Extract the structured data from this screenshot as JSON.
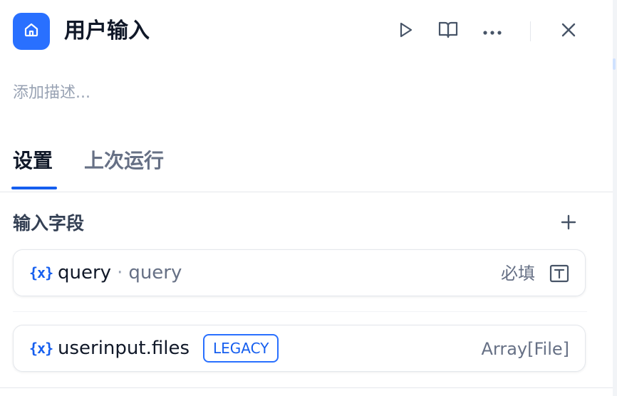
{
  "header": {
    "title": "用户输入",
    "icon": "home-icon",
    "accent_color": "#2970ff"
  },
  "description_placeholder": "添加描述...",
  "tabs": [
    {
      "label": "设置",
      "active": true
    },
    {
      "label": "上次运行",
      "active": false
    }
  ],
  "input_fields": {
    "title": "输入字段",
    "items": [
      {
        "icon_text": "{x}",
        "name": "query",
        "separator": "·",
        "label": "query",
        "required_label": "必填",
        "type_icon": "text-type-icon"
      },
      {
        "icon_text": "{x}",
        "name": "userinput.files",
        "badge": "LEGACY",
        "type": "Array[File]"
      }
    ]
  }
}
